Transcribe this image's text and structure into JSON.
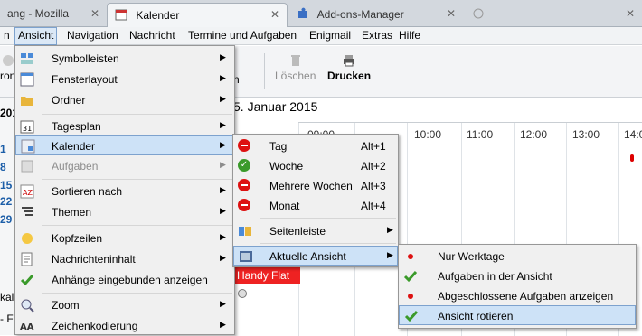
{
  "tabs": {
    "tab1": "ang - Mozilla",
    "tab2": "Kalender",
    "tab3": "Add-ons-Manager",
    "close": "✕"
  },
  "menubar": {
    "items": [
      "Ansicht",
      "Navigation",
      "Nachricht",
      "Termine und Aufgaben",
      "Enigmail",
      "Extras",
      "Hilfe"
    ]
  },
  "toolbar": {
    "delete": "Löschen",
    "print": "Drucken",
    "partial_left": "ron",
    "partial_mid": "n"
  },
  "calendar": {
    "date_header": "5. Januar 2015",
    "times": [
      "09:00",
      "10:00",
      "11:00",
      "12:00",
      "13:00",
      "14:0"
    ],
    "event": "Handy Flat",
    "left_numbers": [
      "201",
      "1",
      "8",
      "15",
      "22",
      "29",
      "kale",
      "- F"
    ]
  },
  "menu_ansicht": {
    "items": [
      {
        "label": "Symbolleisten"
      },
      {
        "label": "Fensterlayout"
      },
      {
        "label": "Ordner"
      },
      {
        "label": "Tagesplan"
      },
      {
        "label": "Kalender"
      },
      {
        "label": "Aufgaben"
      },
      {
        "label": "Sortieren nach"
      },
      {
        "label": "Themen"
      },
      {
        "label": "Kopfzeilen"
      },
      {
        "label": "Nachrichteninhalt"
      },
      {
        "label": "Anhänge eingebunden anzeigen"
      },
      {
        "label": "Zoom"
      },
      {
        "label": "Zeichenkodierung"
      }
    ]
  },
  "menu_kalender": {
    "items": [
      {
        "label": "Tag",
        "accel": "Alt+1"
      },
      {
        "label": "Woche",
        "accel": "Alt+2"
      },
      {
        "label": "Mehrere Wochen",
        "accel": "Alt+3"
      },
      {
        "label": "Monat",
        "accel": "Alt+4"
      },
      {
        "label": "Seitenleiste"
      },
      {
        "label": "Aktuelle Ansicht"
      }
    ]
  },
  "menu_aktuelle": {
    "items": [
      {
        "label": "Nur Werktage"
      },
      {
        "label": "Aufgaben in der Ansicht"
      },
      {
        "label": "Abgeschlossene Aufgaben anzeigen"
      },
      {
        "label": "Ansicht rotieren"
      }
    ]
  },
  "colors": {
    "selection": "#cde2f7",
    "event_red": "#ee2222",
    "accent_blue": "#1c5ea8"
  }
}
